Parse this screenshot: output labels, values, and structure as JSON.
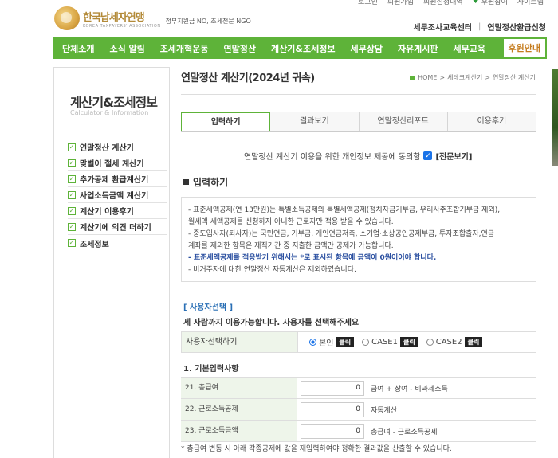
{
  "top_links": [
    "로그인",
    "회원가입",
    "회원신청내역",
    "후원참여",
    "사이트맵"
  ],
  "logo": {
    "title": "한국납세자연맹",
    "subtitle": "KOREA TAXPAYERS' ASSOCIATION",
    "desc": "정부지원금 NO, 조세전문 NGO"
  },
  "util": {
    "left": "세무조사교육센터",
    "sep": "|",
    "right": "연말정산환급신청"
  },
  "nav": [
    "단체소개",
    "소식 알림",
    "조세개혁운동",
    "연말정산",
    "계산기&조세정보",
    "세무상담",
    "자유게시판",
    "세무교육"
  ],
  "nav_active": "후원안내",
  "sidebar": {
    "title": "계산기&조세정보",
    "subtitle": "Calculator & Information",
    "items": [
      "연말정산 계산기",
      "맞벌이 절세 계산기",
      "추가공제 환급계산기",
      "사업소득금액 계산기",
      "계산기 이용후기",
      "계산기에 의견 더하기",
      "조세정보"
    ]
  },
  "page": {
    "title": "연말정산 계산기(2024년 귀속)",
    "breadcrumb": [
      "HOME",
      ">",
      "세테크계산기",
      ">",
      "연말정산 계산기"
    ]
  },
  "tabs": [
    "입력하기",
    "결과보기",
    "연말정산리포트",
    "이용후기"
  ],
  "consent": {
    "text": "연말정산 계산기 이용을 위한 개인정보 제공에 동의함",
    "check": "✓",
    "link": "[전문보기]"
  },
  "section_title": "입력하기",
  "notice": [
    {
      "text": "- 표준세액공제(연 13만원)는 특별소득공제와 특별세액공제(정치자금기부금, 우리사주조합기부금 제외),",
      "blue": false
    },
    {
      "text": "월세액 세액공제를 신청하지 아니한 근로자만 적용 받을 수 있습니다.",
      "blue": false
    },
    {
      "text": "- 중도입사자(퇴사자)는 국민연금, 기부금, 개인연금저축, 소기업·소상공인공제부금, 투자조합출자,연금",
      "blue": false
    },
    {
      "text": "계좌를 제외한 항목은 재직기간 중 지출한 금액만 공제가 가능합니다.",
      "blue": false
    },
    {
      "text": "- 표준세액공제를 적용받기 위해서는 *로 표시된 항목에 금액이 0원이어야 합니다.",
      "blue": true
    },
    {
      "text": "- 비거주자에 대한 연말정산 자동계산은 제외하였습니다.",
      "blue": false
    }
  ],
  "user_select": {
    "title": "[ 사용자선택 ]",
    "desc": "세 사람까지 이용가능합니다. 사용자를 선택해주세요",
    "label": "사용자선택하기",
    "options": [
      "본인",
      "CASE1",
      "CASE2"
    ],
    "button": "클릭",
    "selected": "본인"
  },
  "basic": {
    "title": "1. 기본입력사항",
    "rows": [
      {
        "label": "21. 총급여",
        "value": "0",
        "desc": "급여 + 상여 - 비과세소득"
      },
      {
        "label": "22. 근로소득공제",
        "value": "0",
        "desc": "자동계산"
      },
      {
        "label": "23. 근로소득금액",
        "value": "0",
        "desc": "총급여 - 근로소득공제"
      }
    ],
    "footnote": "* 총급여 변동 시 아래 각종공제에 값을 재입력하여야 정확한 결과값을 산출할 수 있습니다."
  },
  "colors": {
    "accent": "#5eb339",
    "link_blue": "#2a4fa0",
    "active_nav_text": "#c57c1e"
  }
}
